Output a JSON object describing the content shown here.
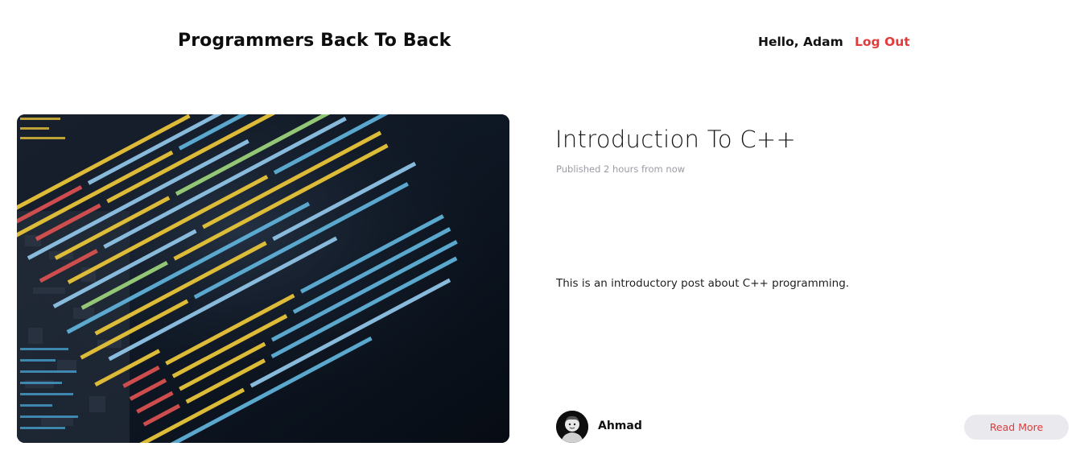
{
  "header": {
    "site_title": "Programmers Back To Back",
    "greeting": "Hello, Adam",
    "logout_label": "Log Out"
  },
  "post": {
    "title": "Introduction To C++",
    "published": "Published 2 hours from now",
    "excerpt": "This is an introductory post about C++ programming.",
    "author": "Ahmad",
    "read_more_label": "Read More",
    "image_icon": "code-screen-photo"
  },
  "colors": {
    "accent": "#e23b3b",
    "muted": "#9b9ba6",
    "button_bg": "#e9e9ee"
  }
}
